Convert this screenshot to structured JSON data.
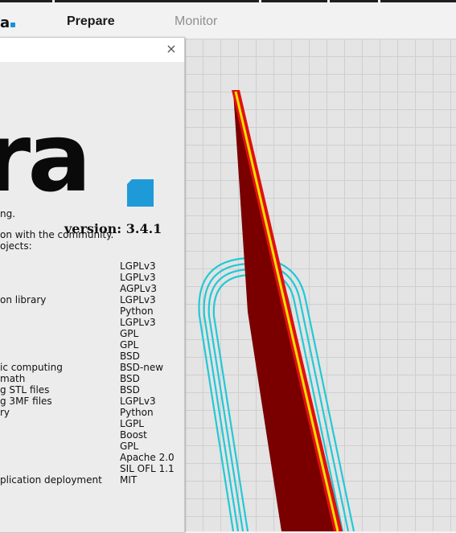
{
  "header": {
    "brand_fragment": "a",
    "stages": {
      "prepare": "Prepare",
      "monitor": "Monitor"
    }
  },
  "dialog": {
    "close_label": "×",
    "logo_text": "ra",
    "version": "version: 3.4.1",
    "intro_fragment": "ng.",
    "community_line": "on with the community.",
    "projects_line": "ojects:",
    "libraries": [
      {
        "desc": "",
        "license": "LGPLv3"
      },
      {
        "desc": "",
        "license": "LGPLv3"
      },
      {
        "desc": "",
        "license": "AGPLv3"
      },
      {
        "desc": "on library",
        "license": "LGPLv3"
      },
      {
        "desc": "",
        "license": "Python"
      },
      {
        "desc": "",
        "license": "LGPLv3"
      },
      {
        "desc": "",
        "license": "GPL"
      },
      {
        "desc": "",
        "license": "GPL"
      },
      {
        "desc": "",
        "license": "BSD"
      },
      {
        "desc": "ic computing",
        "license": "BSD-new"
      },
      {
        "desc": "math",
        "license": "BSD"
      },
      {
        "desc": "g STL files",
        "license": "BSD"
      },
      {
        "desc": "g 3MF files",
        "license": "LGPLv3"
      },
      {
        "desc": "ry",
        "license": "Python"
      },
      {
        "desc": "",
        "license": "LGPL"
      },
      {
        "desc": "",
        "license": "Boost"
      },
      {
        "desc": "",
        "license": "GPL"
      },
      {
        "desc": "",
        "license": "Apache 2.0"
      },
      {
        "desc": "",
        "license": "SIL OFL 1.1"
      },
      {
        "desc": "plication deployment",
        "license": "MIT"
      }
    ]
  },
  "colors": {
    "accent": "#1f9ad9",
    "model_dark": "#7a0000",
    "model_red": "#e01010",
    "model_yellow": "#f5e000",
    "skirt": "#22c9d6"
  }
}
